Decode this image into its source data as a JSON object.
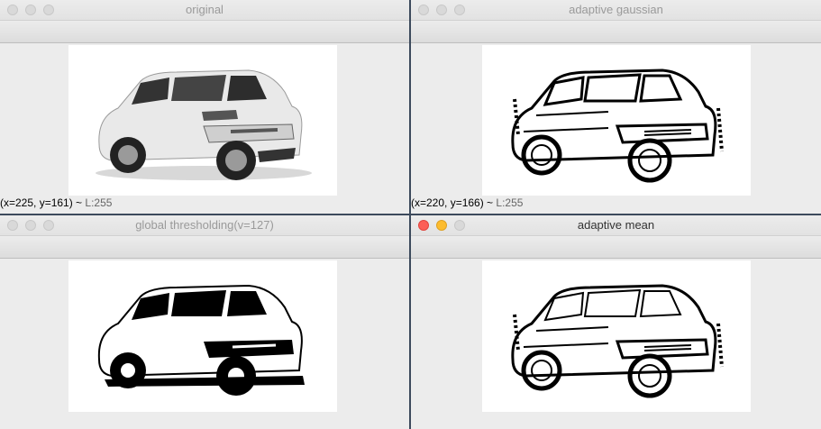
{
  "windows": [
    {
      "title": "original",
      "status_coords": "(x=225, y=161) ~",
      "status_level": "L:255",
      "mode": "gray"
    },
    {
      "title": "adaptive gaussian",
      "status_coords": "(x=220, y=166) ~",
      "status_level": "L:255",
      "mode": "edges"
    },
    {
      "title": "global thresholding(v=127)",
      "status_coords": "",
      "status_level": "",
      "mode": "binary"
    },
    {
      "title": "adaptive mean",
      "status_coords": "",
      "status_level": "",
      "mode": "edges"
    }
  ],
  "colors": {
    "close": "#fc5f57",
    "minimize": "#fdbc2e",
    "separator": "#3c4a5c"
  },
  "icons": [
    "close-icon",
    "minimize-icon",
    "maximize-icon"
  ]
}
